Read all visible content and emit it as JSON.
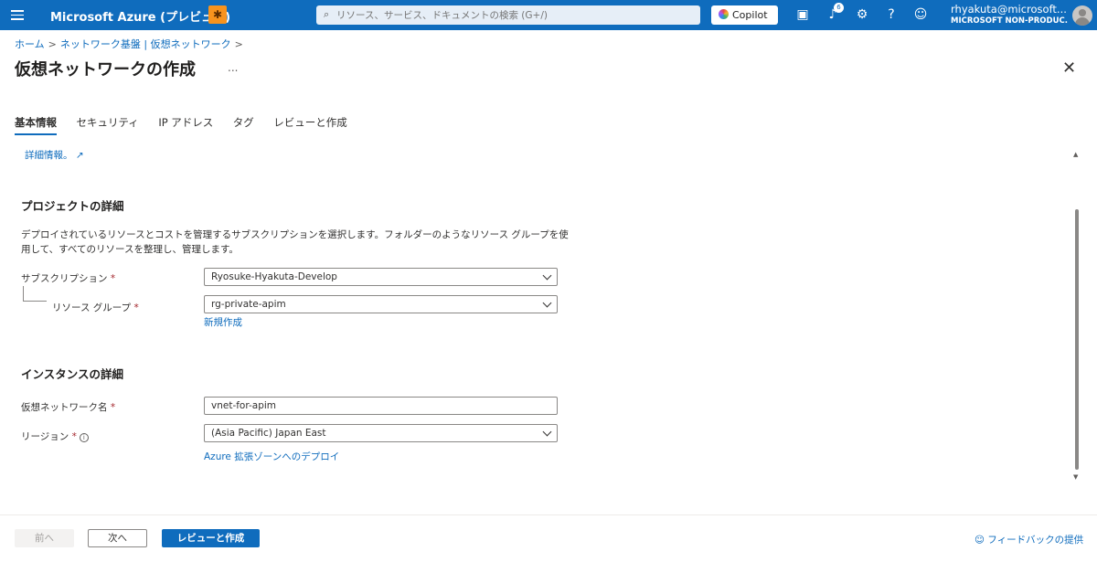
{
  "header": {
    "brand": "Microsoft Azure (プレビュー)",
    "bug_icon": "bug-icon",
    "search": {
      "placeholder": "リソース、サービス、ドキュメントの検索 (G+/)"
    },
    "copilot_label": "Copilot",
    "icons": [
      "cloud-shell-icon",
      "notifications-icon",
      "settings-icon",
      "help-icon",
      "feedback-icon"
    ],
    "notification_count": "6",
    "account": {
      "name": "rhyakuta@microsoft....",
      "org": "MICROSOFT NON-PRODUC..."
    }
  },
  "breadcrumb": {
    "items": [
      "ホーム",
      "ネットワーク基盤 | 仮想ネットワーク"
    ],
    "separator": ">"
  },
  "page": {
    "title": "仮想ネットワークの作成",
    "more": "...",
    "close": "✕"
  },
  "tabs": [
    {
      "label": "基本情報",
      "active": true
    },
    {
      "label": "セキュリティ",
      "active": false
    },
    {
      "label": "IP アドレス",
      "active": false
    },
    {
      "label": "タグ",
      "active": false
    },
    {
      "label": "レビューと作成",
      "active": false
    }
  ],
  "content": {
    "learn_more": "詳細情報。",
    "project": {
      "title": "プロジェクトの詳細",
      "description": "デプロイされているリソースとコストを管理するサブスクリプションを選択します。フォルダーのようなリソース グループを使用して、すべてのリソースを整理し、管理します。",
      "subscription_label": "サブスクリプション",
      "subscription_value": "Ryosuke-Hyakuta-Develop",
      "resource_group_label": "リソース グループ",
      "resource_group_value": "rg-private-apim",
      "create_new": "新規作成"
    },
    "instance": {
      "title": "インスタンスの詳細",
      "vnet_name_label": "仮想ネットワーク名",
      "vnet_name_value": "vnet-for-apim",
      "region_label": "リージョン",
      "region_value": "(Asia Pacific) Japan East",
      "deploy_link": "Azure 拡張ゾーンへのデプロイ"
    },
    "required_mark": "*"
  },
  "footer": {
    "prev": "前へ",
    "next": "次へ",
    "review": "レビューと作成",
    "feedback": "フィードバックの提供"
  },
  "colors": {
    "accent": "#0f6cbd",
    "required": "#a4262c",
    "bug_button": "#f7931e"
  }
}
